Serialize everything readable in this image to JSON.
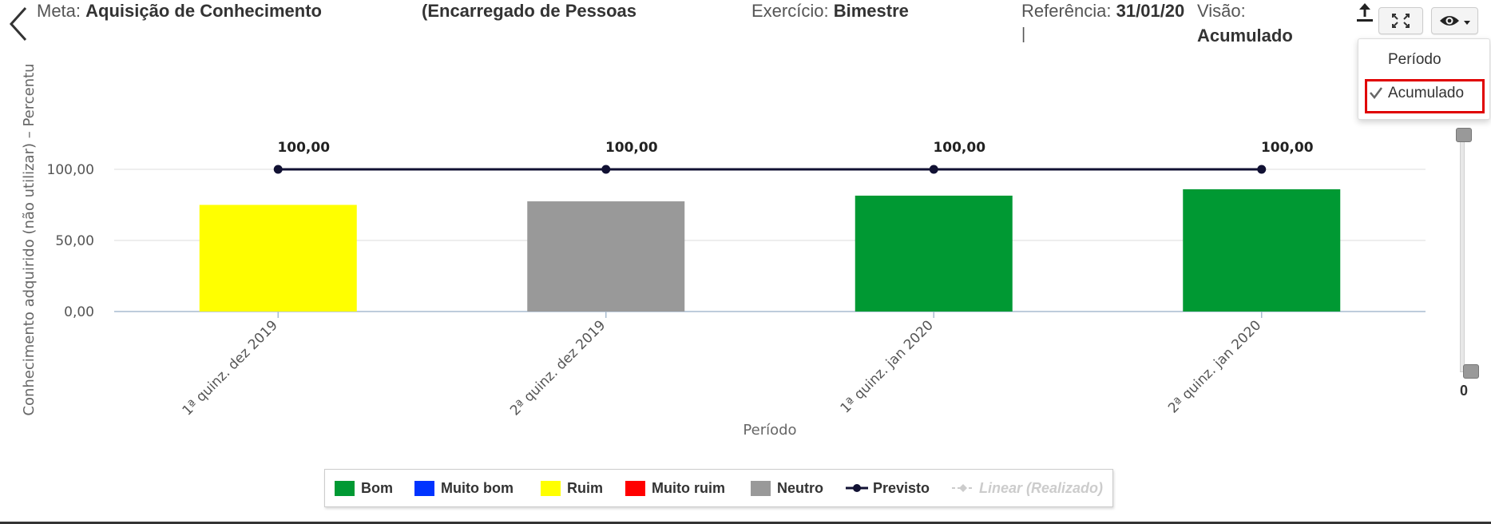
{
  "header": {
    "meta_label": "Meta:",
    "meta_value": "Aquisição de Conhecimento",
    "responsible_value": "(Encarregado de Pessoas",
    "exercise_label": "Exercício:",
    "exercise_value": "Bimestre",
    "reference_label": "Referência:",
    "reference_value": "31/01/20",
    "reference_extra": "|",
    "view_label": "Visão:",
    "view_value": "Acumulado"
  },
  "toolbar": {
    "export_icon": "upload-icon",
    "fullscreen_icon": "expand-icon",
    "view_icon": "eye-icon",
    "dropdown_icon": "caret-down-icon"
  },
  "view_menu": {
    "items": [
      {
        "label": "Período",
        "checked": false
      },
      {
        "label": "Acumulado",
        "checked": true
      }
    ]
  },
  "scroller": {
    "value_label": "0"
  },
  "chart_data": {
    "type": "bar",
    "title": "",
    "xlabel": "Período",
    "ylabel": "Conhecimento adquirido (não utilizar) – Percentu",
    "ylim": [
      0,
      100
    ],
    "yticks": [
      "0,00",
      "50,00",
      "100,00"
    ],
    "categories": [
      "1ª quinz. dez 2019",
      "2ª quinz. dez 2019",
      "1ª quinz. jan 2020",
      "2ª quinz. jan 2020"
    ],
    "series": [
      {
        "name": "Realizado",
        "kind": "bar",
        "values": [
          75,
          77.5,
          81.5,
          86
        ],
        "colors": [
          "#ffff00",
          "#999999",
          "#009933",
          "#009933"
        ]
      },
      {
        "name": "Previsto",
        "kind": "line",
        "values": [
          100,
          100,
          100,
          100
        ],
        "labels": [
          "100,00",
          "100,00",
          "100,00",
          "100,00"
        ],
        "color": "#111133"
      }
    ],
    "grid": true,
    "legend": {
      "position": "bottom",
      "items": [
        {
          "label": "Bom",
          "color": "#009933",
          "symbol": "square"
        },
        {
          "label": "Muito bom",
          "color": "#0033ff",
          "symbol": "square"
        },
        {
          "label": "Ruim",
          "color": "#ffff00",
          "symbol": "square"
        },
        {
          "label": "Muito ruim",
          "color": "#ff0000",
          "symbol": "square"
        },
        {
          "label": "Neutro",
          "color": "#999999",
          "symbol": "square"
        },
        {
          "label": "Previsto",
          "color": "#111133",
          "symbol": "line-dot"
        },
        {
          "label": "Linear (Realizado)",
          "color": "#cccccc",
          "symbol": "line-dot",
          "disabled": true
        }
      ]
    }
  }
}
